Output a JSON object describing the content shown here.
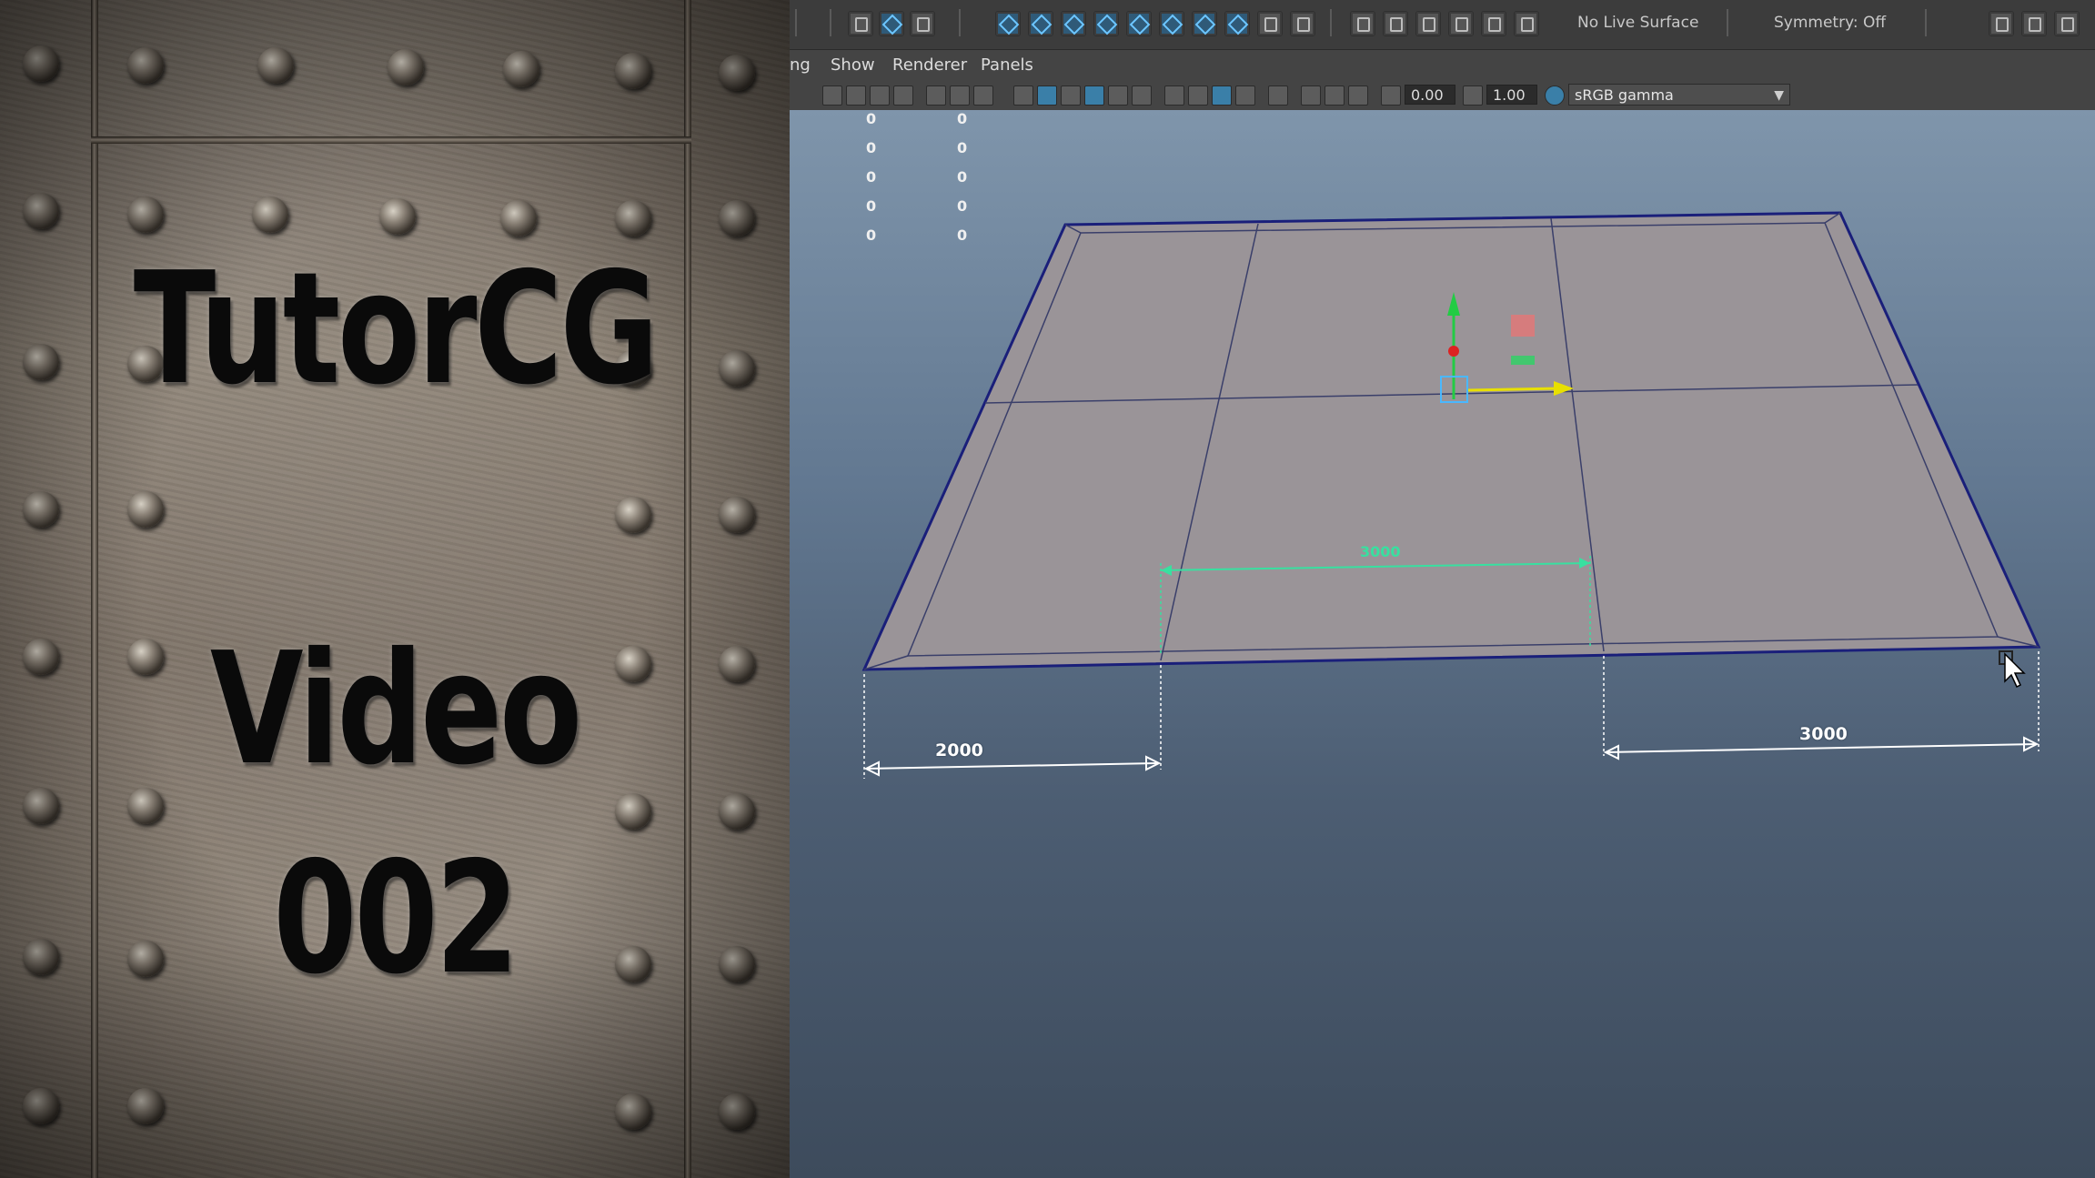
{
  "brand": {
    "line1": "TutorCG",
    "line2": "Video",
    "line3": "002"
  },
  "toolbar": {
    "live_surface_label": "No Live Surface",
    "symmetry_label": "Symmetry: Off"
  },
  "menubar": {
    "items": [
      {
        "label": "ng"
      },
      {
        "label": "Show"
      },
      {
        "label": "Renderer"
      },
      {
        "label": "Panels"
      }
    ]
  },
  "panelbar": {
    "exposure_value": "0.00",
    "gamma_value": "1.00",
    "color_space": "sRGB gamma"
  },
  "hud": {
    "rows": [
      [
        "0",
        "0"
      ],
      [
        "0",
        "0"
      ],
      [
        "0",
        "0"
      ],
      [
        "0",
        "0"
      ],
      [
        "0",
        "0"
      ]
    ]
  },
  "dimensions": {
    "left_label": "2000",
    "right_label": "3000",
    "middle_label": "3000"
  },
  "colors": {
    "mesh_outline": "#1a1f7a",
    "plane_fill": "#9a9498",
    "dimension_green": "#38e0a0",
    "axis_y": "#22cc44",
    "axis_x": "#e8e000"
  }
}
